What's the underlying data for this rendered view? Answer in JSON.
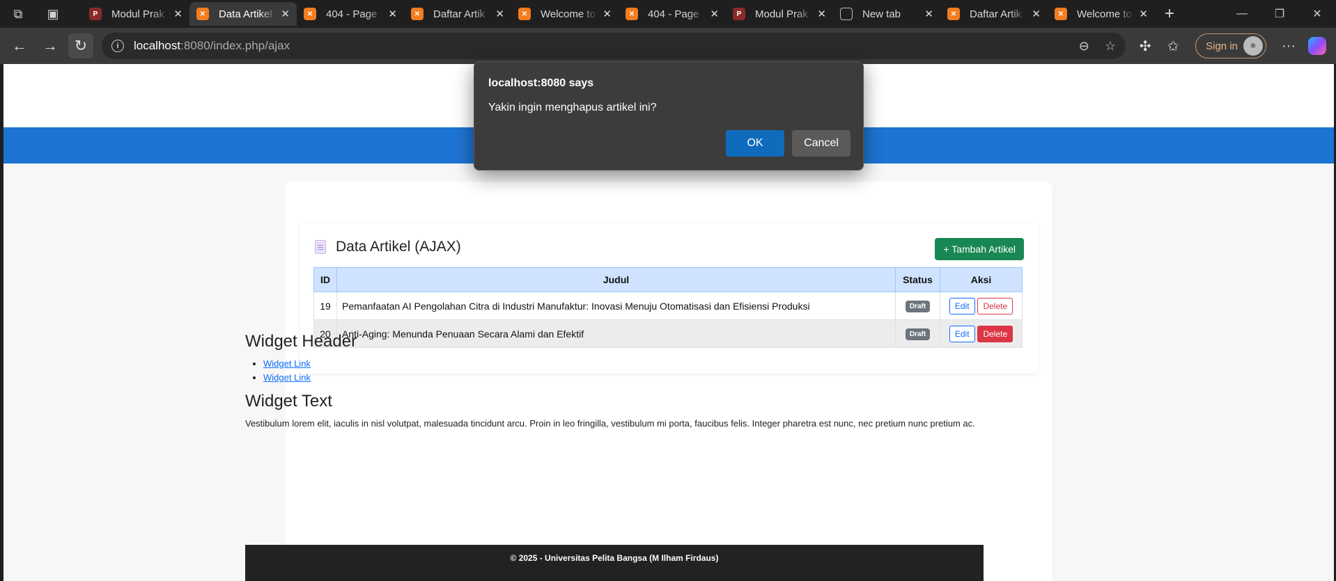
{
  "browser": {
    "tabs": [
      {
        "title": "Modul Prak",
        "favicon": "pdf-icon",
        "active": false
      },
      {
        "title": "Data Artikel",
        "favicon": "xampp-icon",
        "active": true
      },
      {
        "title": "404 - Page",
        "favicon": "xampp-icon",
        "active": false
      },
      {
        "title": "Daftar Artik",
        "favicon": "xampp-icon",
        "active": false
      },
      {
        "title": "Welcome to",
        "favicon": "xampp-icon",
        "active": false
      },
      {
        "title": "404 - Page",
        "favicon": "xampp-icon",
        "active": false
      },
      {
        "title": "Modul Prak",
        "favicon": "pdf-icon",
        "active": false
      },
      {
        "title": "New tab",
        "favicon": "newtab-icon",
        "active": false
      },
      {
        "title": "Daftar Artik",
        "favicon": "xampp-icon",
        "active": false
      },
      {
        "title": "Welcome to",
        "favicon": "xampp-icon",
        "active": false
      }
    ],
    "url_host": "localhost",
    "url_path": ":8080/index.php/ajax",
    "sign_in_label": "Sign in"
  },
  "page": {
    "card_title": "Data Artikel (AJAX)",
    "add_button": "+ Tambah Artikel",
    "columns": [
      "ID",
      "Judul",
      "Status",
      "Aksi"
    ],
    "rows": [
      {
        "id": "19",
        "judul": "Pemanfaatan AI Pengolahan Citra di Industri Manufaktur: Inovasi Menuju Otomatisasi dan Efisiensi Produksi",
        "status": "Draft",
        "edit": "Edit",
        "delete": "Delete"
      },
      {
        "id": "20",
        "judul": "Anti-Aging: Menunda Penuaan Secara Alami dan Efektif",
        "status": "Draft",
        "edit": "Edit",
        "delete": "Delete"
      }
    ],
    "widget_header": "Widget Header",
    "widget_links": [
      "Widget Link",
      "Widget Link"
    ],
    "widget_text_title": "Widget Text",
    "widget_text": "Vestibulum lorem elit, iaculis in nisl volutpat, malesuada tincidunt arcu. Proin in leo fringilla, vestibulum mi porta, faucibus felis. Integer pharetra est nunc, nec pretium nunc pretium ac.",
    "footer": "© 2025 - Universitas Pelita Bangsa (M Ilham Firdaus)"
  },
  "dialog": {
    "title": "localhost:8080 says",
    "message": "Yakin ingin menghapus artikel ini?",
    "ok": "OK",
    "cancel": "Cancel"
  },
  "colors": {
    "nav_blue": "#1e74d3",
    "table_header": "#cfe2ff",
    "success": "#198754",
    "danger": "#dc3545",
    "primary": "#0d6efd",
    "dialog_ok": "#0f6cbd"
  }
}
